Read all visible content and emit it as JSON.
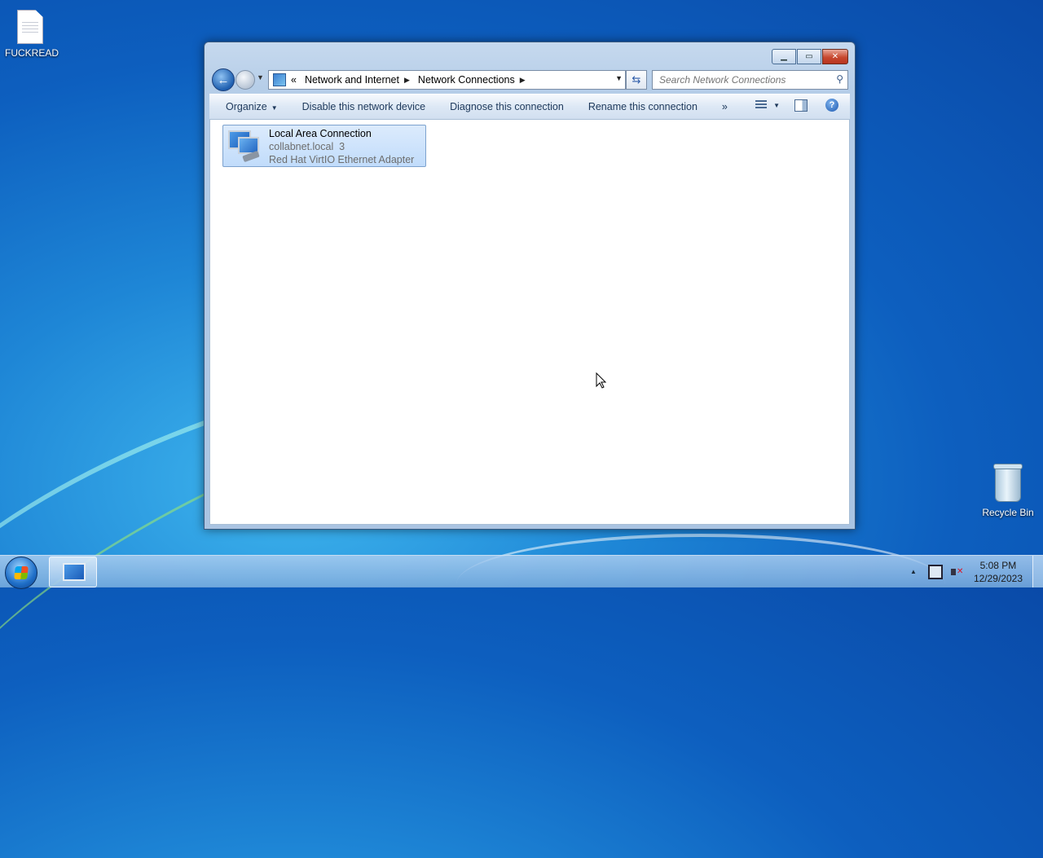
{
  "desktop": {
    "icons": [
      {
        "label": "FUCKREAD"
      },
      {
        "label": "Recycle Bin"
      }
    ]
  },
  "window": {
    "caption_buttons": {
      "minimize": "minimize-icon",
      "maximize": "maximize-icon",
      "close": "close-icon"
    },
    "address": {
      "overflow": "«",
      "crumbs": [
        "Network and Internet",
        "Network Connections"
      ]
    },
    "search": {
      "placeholder": "Search Network Connections"
    },
    "toolbar": {
      "organize": "Organize",
      "disable": "Disable this network device",
      "diagnose": "Diagnose this connection",
      "rename": "Rename this connection",
      "more": "»"
    },
    "items": [
      {
        "name": "Local Area Connection",
        "network": "collabnet.local  3",
        "adapter": "Red Hat VirtIO Ethernet Adapter"
      }
    ]
  },
  "taskbar": {
    "clock": {
      "time": "5:08 PM",
      "date": "12/29/2023"
    }
  }
}
